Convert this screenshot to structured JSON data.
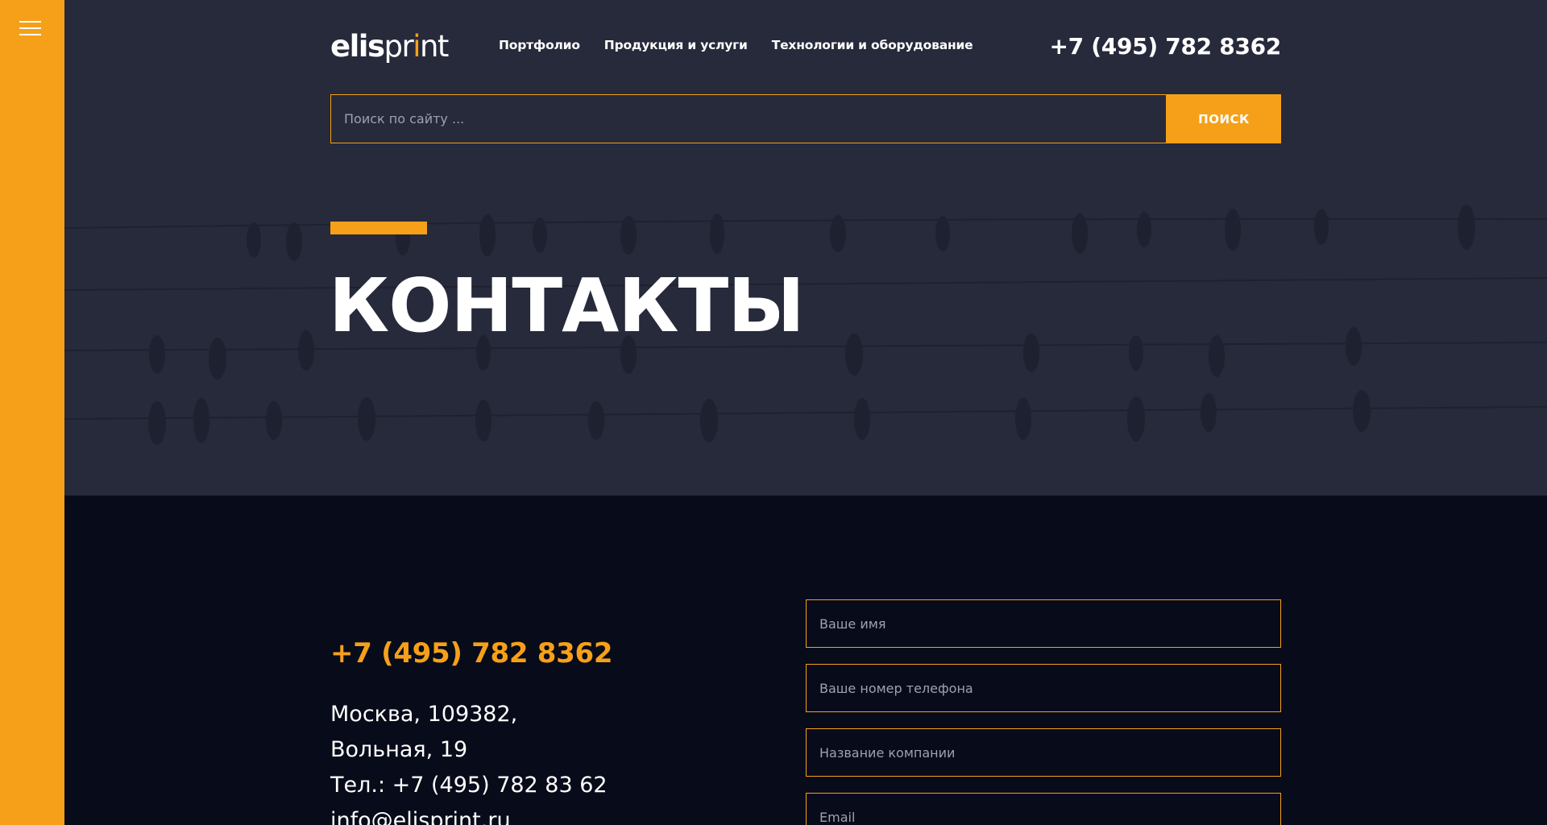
{
  "sidebar": {
    "menu_icon": "hamburger-menu-icon"
  },
  "header": {
    "logo": {
      "part1": "elis",
      "part2": "pr",
      "part3": "i",
      "part4": "nt"
    },
    "nav": [
      {
        "label": "Портфолио"
      },
      {
        "label": "Продукция и услуги"
      },
      {
        "label": "Технологии и оборудование"
      }
    ],
    "phone": "+7 (495) 782 8362"
  },
  "search": {
    "placeholder": "Поиск по сайту ...",
    "button_label": "ПОИСК"
  },
  "hero": {
    "title": "КОНТАКТЫ"
  },
  "contacts": {
    "phone": "+7 (495) 782 8362",
    "address_line1": "Москва, 109382,",
    "address_line2": "Вольная, 19",
    "tel_line": "Тел.: +7 (495) 782 83 62",
    "email": "info@elisprint.ru"
  },
  "form": {
    "name_placeholder": "Ваше имя",
    "phone_placeholder": "Ваше номер телефона",
    "company_placeholder": "Название компании",
    "email_placeholder": "Email"
  },
  "colors": {
    "accent": "#f6a019",
    "hero_bg": "#262a3b",
    "page_bg": "#080b19",
    "text": "#ffffff"
  }
}
